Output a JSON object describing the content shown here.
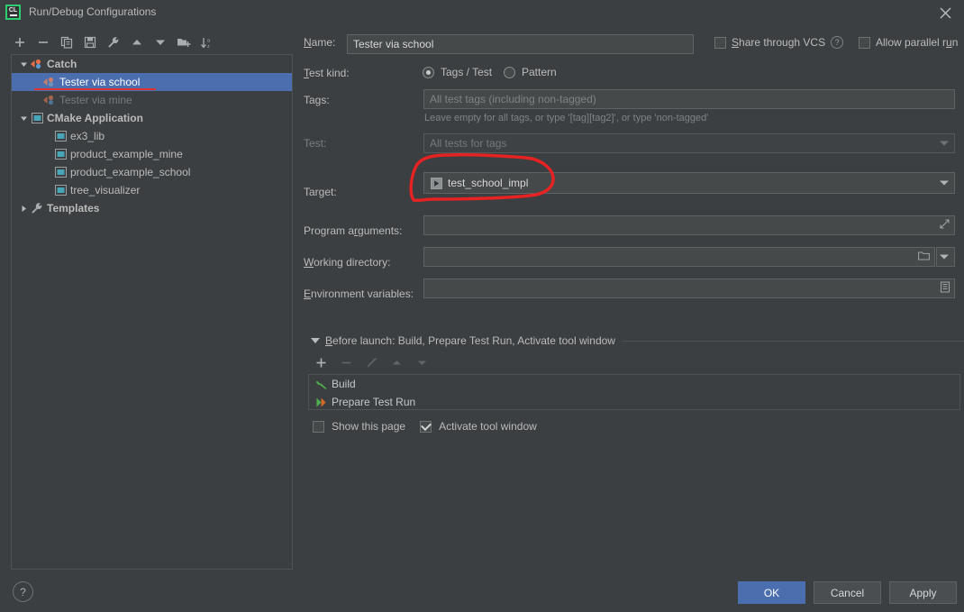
{
  "window": {
    "title": "Run/Debug Configurations",
    "app_icon": "clion-icon",
    "app_icon_text": "CL",
    "close_icon": "close-icon"
  },
  "left_toolbar": {
    "buttons": [
      {
        "name": "add-configuration-button",
        "icon": "plus-icon",
        "title": "Add New Configuration"
      },
      {
        "name": "remove-configuration-button",
        "icon": "minus-icon",
        "title": "Remove Configuration"
      },
      {
        "name": "copy-configuration-button",
        "icon": "copy-icon",
        "title": "Copy Configuration"
      },
      {
        "name": "save-configuration-button",
        "icon": "save-icon",
        "title": "Save Configuration"
      },
      {
        "name": "edit-templates-button",
        "icon": "wrench-icon",
        "title": "Edit Templates"
      },
      {
        "name": "move-up-button",
        "icon": "arrow-up-icon",
        "title": "Move Up"
      },
      {
        "name": "move-down-button",
        "icon": "arrow-down-icon",
        "title": "Move Down"
      },
      {
        "name": "new-folder-button",
        "icon": "folder-add-icon",
        "title": "Create New Folder"
      },
      {
        "name": "sort-configurations-button",
        "icon": "sort-az-icon",
        "title": "Sort Configurations"
      }
    ]
  },
  "tree": {
    "items": [
      {
        "label": "Catch",
        "icon": "catch-icon",
        "level": 0,
        "expanded": true,
        "bold": true,
        "selected": false,
        "dim": false
      },
      {
        "label": "Tester via school",
        "icon": "catch-icon",
        "level": 1,
        "expanded": null,
        "bold": false,
        "selected": true,
        "dim": false
      },
      {
        "label": "Tester via mine",
        "icon": "catch-icon",
        "level": 1,
        "expanded": null,
        "bold": false,
        "selected": false,
        "dim": true
      },
      {
        "label": "CMake Application",
        "icon": "cmake-icon",
        "level": 0,
        "expanded": true,
        "bold": true,
        "selected": false,
        "dim": false
      },
      {
        "label": "ex3_lib",
        "icon": "cmake-icon",
        "level": 1,
        "expanded": null,
        "bold": false,
        "selected": false,
        "dim": false
      },
      {
        "label": "product_example_mine",
        "icon": "cmake-icon",
        "level": 1,
        "expanded": null,
        "bold": false,
        "selected": false,
        "dim": false
      },
      {
        "label": "product_example_school",
        "icon": "cmake-icon",
        "level": 1,
        "expanded": null,
        "bold": false,
        "selected": false,
        "dim": false
      },
      {
        "label": "tree_visualizer",
        "icon": "cmake-icon",
        "level": 1,
        "expanded": null,
        "bold": false,
        "selected": false,
        "dim": false
      },
      {
        "label": "Templates",
        "icon": "wrench-icon",
        "level": 0,
        "expanded": false,
        "bold": true,
        "selected": false,
        "dim": false
      }
    ]
  },
  "form": {
    "name_label": "Name:",
    "name_value": "Tester via school",
    "share_vcs_label": "Share through VCS",
    "share_vcs_checked": false,
    "help_icon": "question-mark-icon",
    "allow_parallel_label": "Allow parallel run",
    "allow_parallel_checked": false,
    "test_kind_label": "Test kind:",
    "test_kind_options": [
      "Tags / Test",
      "Pattern"
    ],
    "test_kind_selected": "Tags / Test",
    "tags_label": "Tags:",
    "tags_placeholder": "All test tags (including non-tagged)",
    "tags_hint": "Leave empty for all tags, or type '[tag][tag2]', or type 'non-tagged'",
    "test_label": "Test:",
    "test_placeholder": "All tests for tags",
    "target_label": "Target:",
    "target_value": "test_school_impl",
    "target_icon": "run-target-icon",
    "program_arguments_label": "Program arguments:",
    "program_arguments_value": "",
    "expand_icon": "expand-editor-icon",
    "working_directory_label": "Working directory:",
    "working_directory_value": "",
    "browse_icon": "folder-icon",
    "environment_variables_label": "Environment variables:",
    "environment_variables_value": "",
    "env_icon": "env-list-icon"
  },
  "before_launch": {
    "header": "Before launch: Build, Prepare Test Run, Activate tool window",
    "toolbar": [
      {
        "name": "add-task-button",
        "icon": "plus-icon",
        "enabled": true
      },
      {
        "name": "remove-task-button",
        "icon": "minus-icon",
        "enabled": false
      },
      {
        "name": "edit-task-button",
        "icon": "pencil-icon",
        "enabled": false
      },
      {
        "name": "move-task-up-button",
        "icon": "arrow-up-icon",
        "enabled": false
      },
      {
        "name": "move-task-down-button",
        "icon": "arrow-down-icon",
        "enabled": false
      }
    ],
    "tasks": [
      {
        "label": "Build",
        "icon": "hammer-icon"
      },
      {
        "label": "Prepare Test Run",
        "icon": "run-tests-icon"
      }
    ],
    "show_this_page_label": "Show this page",
    "show_this_page_checked": false,
    "activate_tool_window_label": "Activate tool window",
    "activate_tool_window_checked": true
  },
  "footer": {
    "help_label": "?",
    "ok_label": "OK",
    "cancel_label": "Cancel",
    "apply_label": "Apply"
  },
  "annotations": {
    "target_highlight_color": "#e62222",
    "selected_item_underline_color": "#e03030"
  },
  "colors": {
    "window_bg": "#3c3f41",
    "field_bg": "#45494a",
    "selection_bg": "#4b6eaf",
    "text": "#bbbbbb",
    "accent_green": "#2ecc71"
  }
}
